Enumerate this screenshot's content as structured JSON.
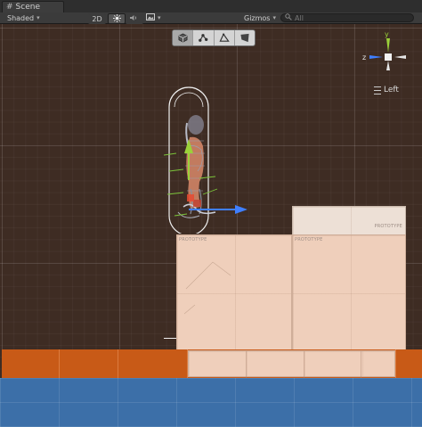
{
  "window": {
    "tab_title": "Scene",
    "tab_icon": "scene-hash-icon"
  },
  "toolbar": {
    "shading_mode": "Shaded",
    "mode_2d": "2D",
    "lighting_icon": "sun-icon",
    "audio_icon": "speaker-icon",
    "effects_icon": "image-effects-icon",
    "gizmos_label": "Gizmos",
    "search_placeholder": "All",
    "search_icon": "search-icon"
  },
  "tool_palette": {
    "tools": [
      "move-cube-icon",
      "bone-tool-icon",
      "vertex-tool-icon",
      "fill-tool-icon"
    ],
    "active_index": 0
  },
  "orientation_gizmo": {
    "axis_y": "y",
    "axis_z": "z",
    "view_label": "Left",
    "colors": {
      "y": "#9bd13a",
      "z": "#3f7fff",
      "x": "#e0e0e0"
    }
  },
  "scene": {
    "colors": {
      "background": "#3e2c23",
      "platform_orange": "#c85a17",
      "ground_blue": "#3c6fa8",
      "prototype_box": "#efcfbb",
      "prototype_box_light": "#ede0d6",
      "move_handle_y": "#9bd13a",
      "move_handle_z": "#3f7fff",
      "capsule_collider": "#f0f0f0",
      "character_wire": "#9aa0b0"
    },
    "box_labels": {
      "top": "PROTOTYPE",
      "left": "PROTOTYPE",
      "right": "PROTOTYPE"
    }
  }
}
